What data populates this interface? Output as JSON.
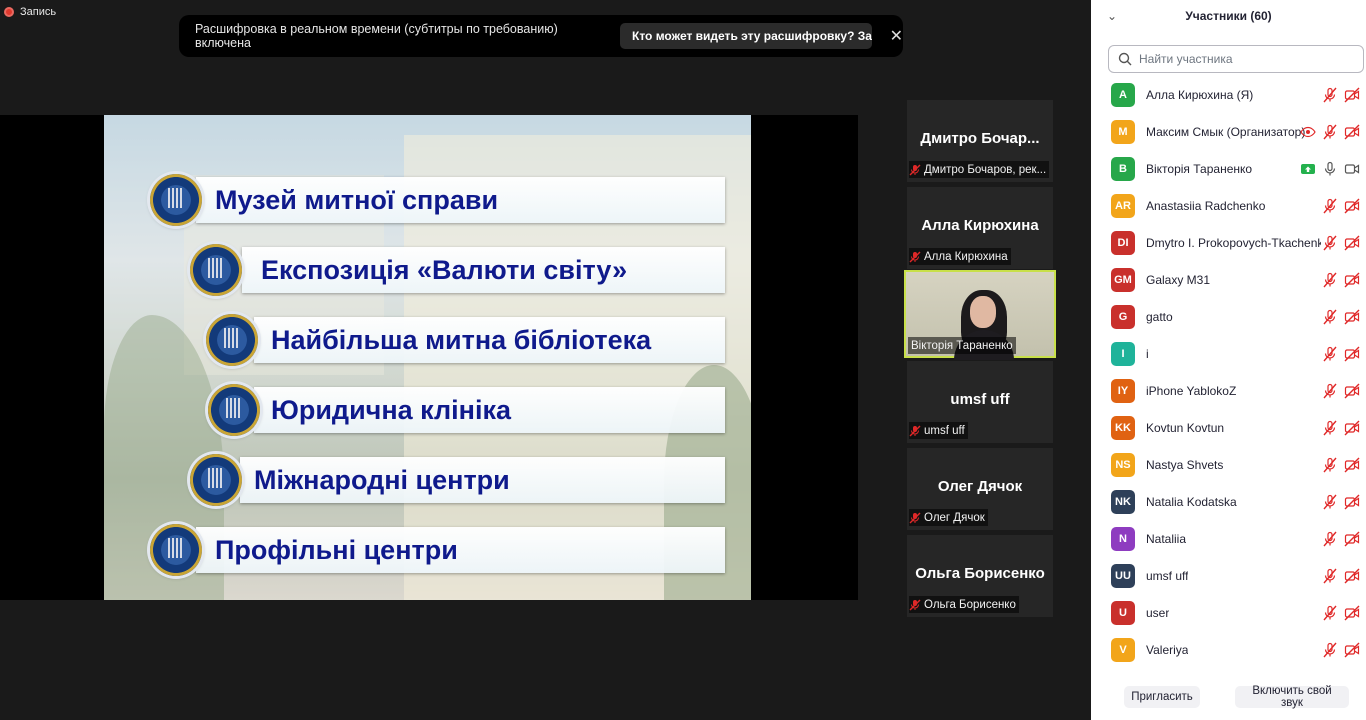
{
  "recording": {
    "label": "Запись"
  },
  "banner": {
    "text": "Расшифровка в реальном времени (субтитры по требованию) включена",
    "button": "Кто может видеть эту расшифровку? За...",
    "close": "✕"
  },
  "slide": {
    "items": [
      "Музей митної справи",
      "Експозиція «Валюти світу»",
      "Найбільша митна бібліотека",
      "Юридична клініка",
      "Міжнародні центри",
      "Профільні центри"
    ]
  },
  "tiles": [
    {
      "big": "Дмитро  Бочар...",
      "label": "Дмитро Бочаров, рек..."
    },
    {
      "big": "Алла Кирюхина",
      "label": "Алла Кирюхина"
    },
    {
      "big": "",
      "label": "Вікторія Тараненко"
    },
    {
      "big": "umsf uff",
      "label": "umsf uff"
    },
    {
      "big": "Олег Дячок",
      "label": "Олег Дячок"
    },
    {
      "big": "Ольга Борисенко",
      "label": "Ольга Борисенко"
    }
  ],
  "panel": {
    "title": "Участники (60)",
    "search_placeholder": "Найти участника",
    "participants": [
      {
        "initials": "A",
        "name": "Алла Кирюхина (Я)",
        "color": "#27a74a",
        "mic": "muted",
        "cam": "off"
      },
      {
        "initials": "M",
        "name": "Максим Смык (Организатор)",
        "color": "#f2a51a",
        "mic": "muted",
        "cam": "off",
        "role_icon": "eye-icon"
      },
      {
        "initials": "B",
        "name": "Вікторія Тараненко",
        "color": "#27a74a",
        "mic": "on",
        "cam": "on",
        "share_icon": "screen-share-icon"
      },
      {
        "initials": "AR",
        "name": "Anastasiia Radchenko",
        "color": "#f2a51a",
        "mic": "muted",
        "cam": "off"
      },
      {
        "initials": "DI",
        "name": "Dmytro I. Prokopovych-Tkachenko",
        "color": "#c9302c",
        "mic": "muted",
        "cam": "off"
      },
      {
        "initials": "GM",
        "name": "Galaxy M31",
        "color": "#c9302c",
        "mic": "muted",
        "cam": "off"
      },
      {
        "initials": "G",
        "name": "gatto",
        "color": "#c9302c",
        "mic": "muted",
        "cam": "off"
      },
      {
        "initials": "I",
        "name": "i",
        "color": "#1fb39a",
        "mic": "muted",
        "cam": "off"
      },
      {
        "initials": "IY",
        "name": "iPhone YablokoZ",
        "color": "#e06212",
        "mic": "muted",
        "cam": "off"
      },
      {
        "initials": "KK",
        "name": "Kovtun Kovtun",
        "color": "#e06212",
        "mic": "muted",
        "cam": "off"
      },
      {
        "initials": "NS",
        "name": "Nastya Shvets",
        "color": "#f2a51a",
        "mic": "muted",
        "cam": "off"
      },
      {
        "initials": "NK",
        "name": "Natalia Kodatska",
        "color": "#2e4059",
        "mic": "muted",
        "cam": "off"
      },
      {
        "initials": "N",
        "name": "Nataliia",
        "color": "#8e3cc0",
        "mic": "muted",
        "cam": "off"
      },
      {
        "initials": "UU",
        "name": "umsf uff",
        "color": "#2e4059",
        "mic": "muted",
        "cam": "off"
      },
      {
        "initials": "U",
        "name": "user",
        "color": "#c9302c",
        "mic": "muted",
        "cam": "off"
      },
      {
        "initials": "V",
        "name": "Valeriya",
        "color": "#f2a51a",
        "mic": "muted",
        "cam": "off"
      }
    ],
    "invite": "Пригласить",
    "unmute": "Включить свой звук"
  }
}
